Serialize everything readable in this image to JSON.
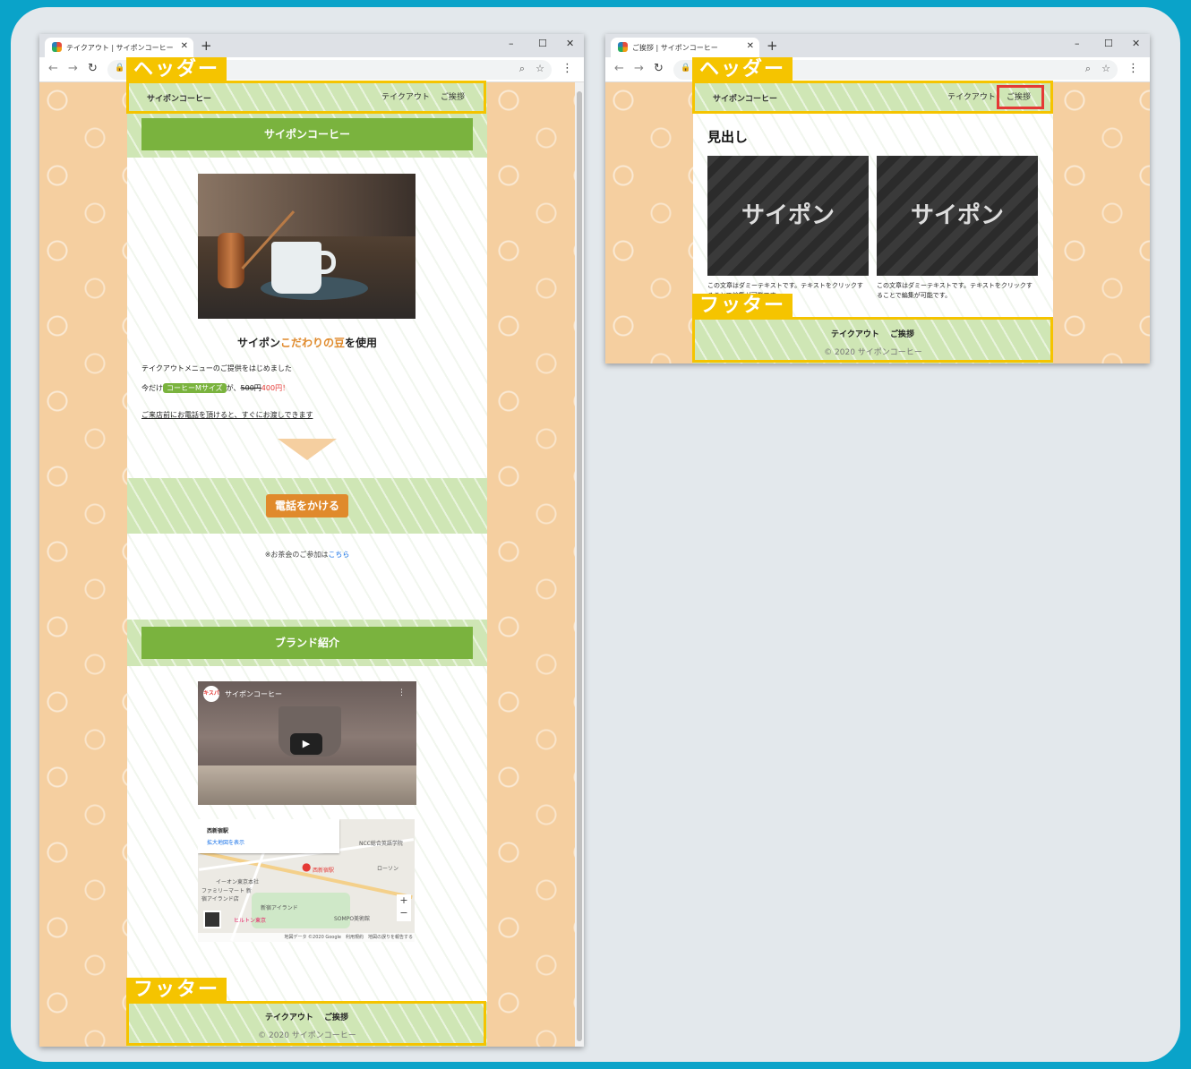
{
  "colors": {
    "border": "#0aa3c9",
    "highlight": "#f5c400",
    "green": "#7ab33e",
    "orange": "#e08a2c",
    "sidebar_bg": "#f5cfa0"
  },
  "annotations": {
    "header_tag": "ヘッダー",
    "footer_tag": "フッター"
  },
  "browser_left": {
    "tab_title": "テイクアウト | サイポンコーヒー",
    "header": {
      "logo": "サイポンコーヒー",
      "nav": [
        "テイクアウト",
        "ご挨拶"
      ]
    },
    "main": {
      "title_bar": "サイポンコーヒー",
      "headline_before": "サイポン",
      "headline_accent": "こだわりの豆",
      "headline_after": "を使用",
      "line1": "テイクアウトメニューのご提供をはじめました",
      "line2_prefix": "今だけ",
      "line2_badge": "コーヒーMサイズ",
      "line2_mid": "が、",
      "line2_old_price": "500円",
      "line2_new_price": "400円！",
      "line3": "ご来店前にお電話を頂けると、すぐにお渡しできます",
      "call_button": "電話をかける",
      "tea_note": "※お茶会のご参加は",
      "tea_link": "こちら",
      "brand_bar": "ブランド紹介",
      "video_title": "サイポンコーヒー",
      "video_channel_icon": "キスパ",
      "map_place": "西新宿駅",
      "map_link": "拡大地図を表示",
      "map_pin_label": "西新宿駅",
      "map_footer": "地図データ ©2020 Google　利用規約　地図の誤りを報告する",
      "map_labels": [
        "NCC総合英語学院",
        "イーオン東京本社",
        "ファミリーマート 新宿アイランド店",
        "新宿アイランド",
        "ヒルトン東京",
        "SOMPO美術館",
        "ローソン"
      ]
    },
    "footer": {
      "nav": [
        "テイクアウト",
        "ご挨拶"
      ],
      "copyright": "© 2020 サイポンコーヒー"
    }
  },
  "browser_right": {
    "tab_title": "ご挨拶 | サイポンコーヒー",
    "header": {
      "logo": "サイポンコーヒー",
      "nav": [
        "テイクアウト",
        "ご挨拶"
      ]
    },
    "main": {
      "heading": "見出し",
      "cards": [
        {
          "image_text": "サイポン",
          "text": "この文章はダミーテキストです。テキストをクリックすることで編集が可能です。"
        },
        {
          "image_text": "サイポン",
          "text": "この文章はダミーテキストです。テキストをクリックすることで編集が可能です。"
        }
      ]
    },
    "footer": {
      "nav": [
        "テイクアウト",
        "ご挨拶"
      ],
      "copyright": "© 2020 サイポンコーヒー"
    }
  }
}
